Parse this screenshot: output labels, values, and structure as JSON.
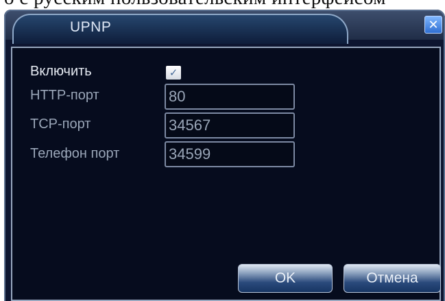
{
  "top_text": "о с русским пользовательским интерфейсом",
  "window": {
    "title": "UPNP",
    "close_label": "✕"
  },
  "form": {
    "enable": {
      "label": "Включить",
      "checked": true,
      "check_glyph": "✓"
    },
    "http_port": {
      "label": "HTTP-порт",
      "value": "80"
    },
    "tcp_port": {
      "label": "TCP-порт",
      "value": "34567"
    },
    "phone_port": {
      "label": "Телефон порт",
      "value": "34599"
    }
  },
  "buttons": {
    "ok": "OK",
    "cancel": "Отмена"
  },
  "colors": {
    "background": "#060c1e",
    "title_text": "#dfe8f6",
    "close_accent": "#2f6fd1"
  }
}
